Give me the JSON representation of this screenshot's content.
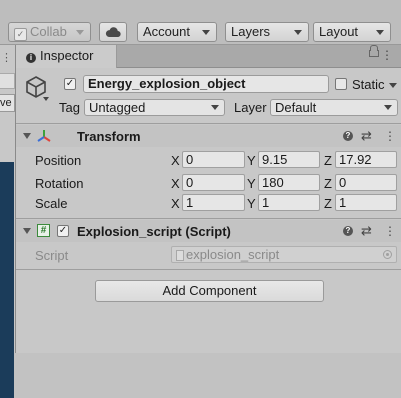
{
  "toolbar": {
    "collab_label": "Collab",
    "account_label": "Account",
    "layers_label": "Layers",
    "layout_label": "Layout"
  },
  "left_panel": {
    "partial_text": "ve"
  },
  "inspector": {
    "tab_label": "Inspector",
    "gameobject": {
      "active": true,
      "name": "Energy_explosion_object",
      "static_label": "Static",
      "static": false,
      "tag_label": "Tag",
      "tag_value": "Untagged",
      "layer_label": "Layer",
      "layer_value": "Default"
    },
    "transform": {
      "title": "Transform",
      "rows": [
        {
          "label": "Position",
          "x": "0",
          "y": "9.15",
          "z": "17.92"
        },
        {
          "label": "Rotation",
          "x": "0",
          "y": "180",
          "z": "0"
        },
        {
          "label": "Scale",
          "x": "1",
          "y": "1",
          "z": "1"
        }
      ],
      "axis_x": "X",
      "axis_y": "Y",
      "axis_z": "Z"
    },
    "script_component": {
      "enabled": true,
      "title": "Explosion_script (Script)",
      "field_label": "Script",
      "field_value": "explosion_script"
    },
    "add_component_label": "Add Component"
  },
  "colors": {
    "panel_bg": "#c8c8c8",
    "scene_blue": "#1b3c5a",
    "transform_axis_red": "#e0433b",
    "transform_axis_green": "#3da23c",
    "transform_axis_blue": "#3c6fd6",
    "script_icon_green": "#3b8a3b"
  }
}
